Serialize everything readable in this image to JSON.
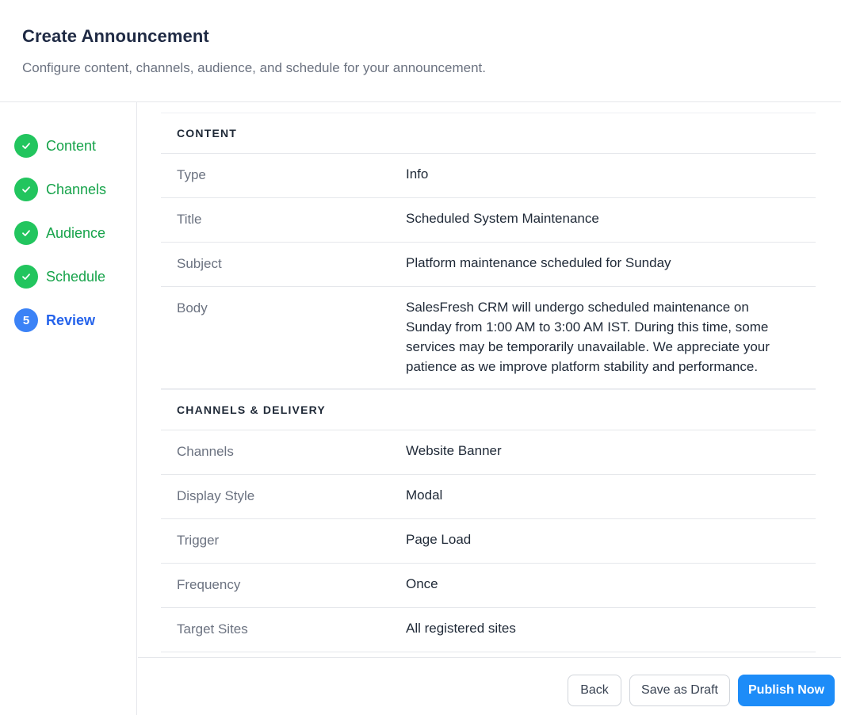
{
  "header": {
    "title": "Create Announcement",
    "subtitle": "Configure content, channels, audience, and schedule for your announcement."
  },
  "steps": [
    {
      "label": "Content",
      "status": "done",
      "icon": "check-icon"
    },
    {
      "label": "Channels",
      "status": "done",
      "icon": "check-icon"
    },
    {
      "label": "Audience",
      "status": "done",
      "icon": "check-icon"
    },
    {
      "label": "Schedule",
      "status": "done",
      "icon": "check-icon"
    },
    {
      "label": "Review",
      "status": "active",
      "number": "5"
    }
  ],
  "review": {
    "content": {
      "heading": "CONTENT",
      "rows": [
        {
          "label": "Type",
          "value": "Info"
        },
        {
          "label": "Title",
          "value": "Scheduled System Maintenance"
        },
        {
          "label": "Subject",
          "value": "Platform maintenance scheduled for Sunday"
        },
        {
          "label": "Body",
          "value": "SalesFresh CRM will undergo scheduled maintenance on Sunday from 1:00 AM to 3:00 AM IST. During this time, some services may be temporarily unavailable. We appreciate your patience as we improve platform stability and performance."
        }
      ]
    },
    "channels": {
      "heading": "CHANNELS & DELIVERY",
      "rows": [
        {
          "label": "Channels",
          "value": "Website Banner"
        },
        {
          "label": "Display Style",
          "value": "Modal"
        },
        {
          "label": "Trigger",
          "value": "Page Load"
        },
        {
          "label": "Frequency",
          "value": "Once"
        },
        {
          "label": "Target Sites",
          "value": "All registered sites"
        }
      ]
    }
  },
  "footer": {
    "back_label": "Back",
    "draft_label": "Save as Draft",
    "publish_label": "Publish Now"
  },
  "colors": {
    "done": "#22c55e",
    "active": "#3b82f6",
    "primary_button": "#1d8cf8"
  }
}
